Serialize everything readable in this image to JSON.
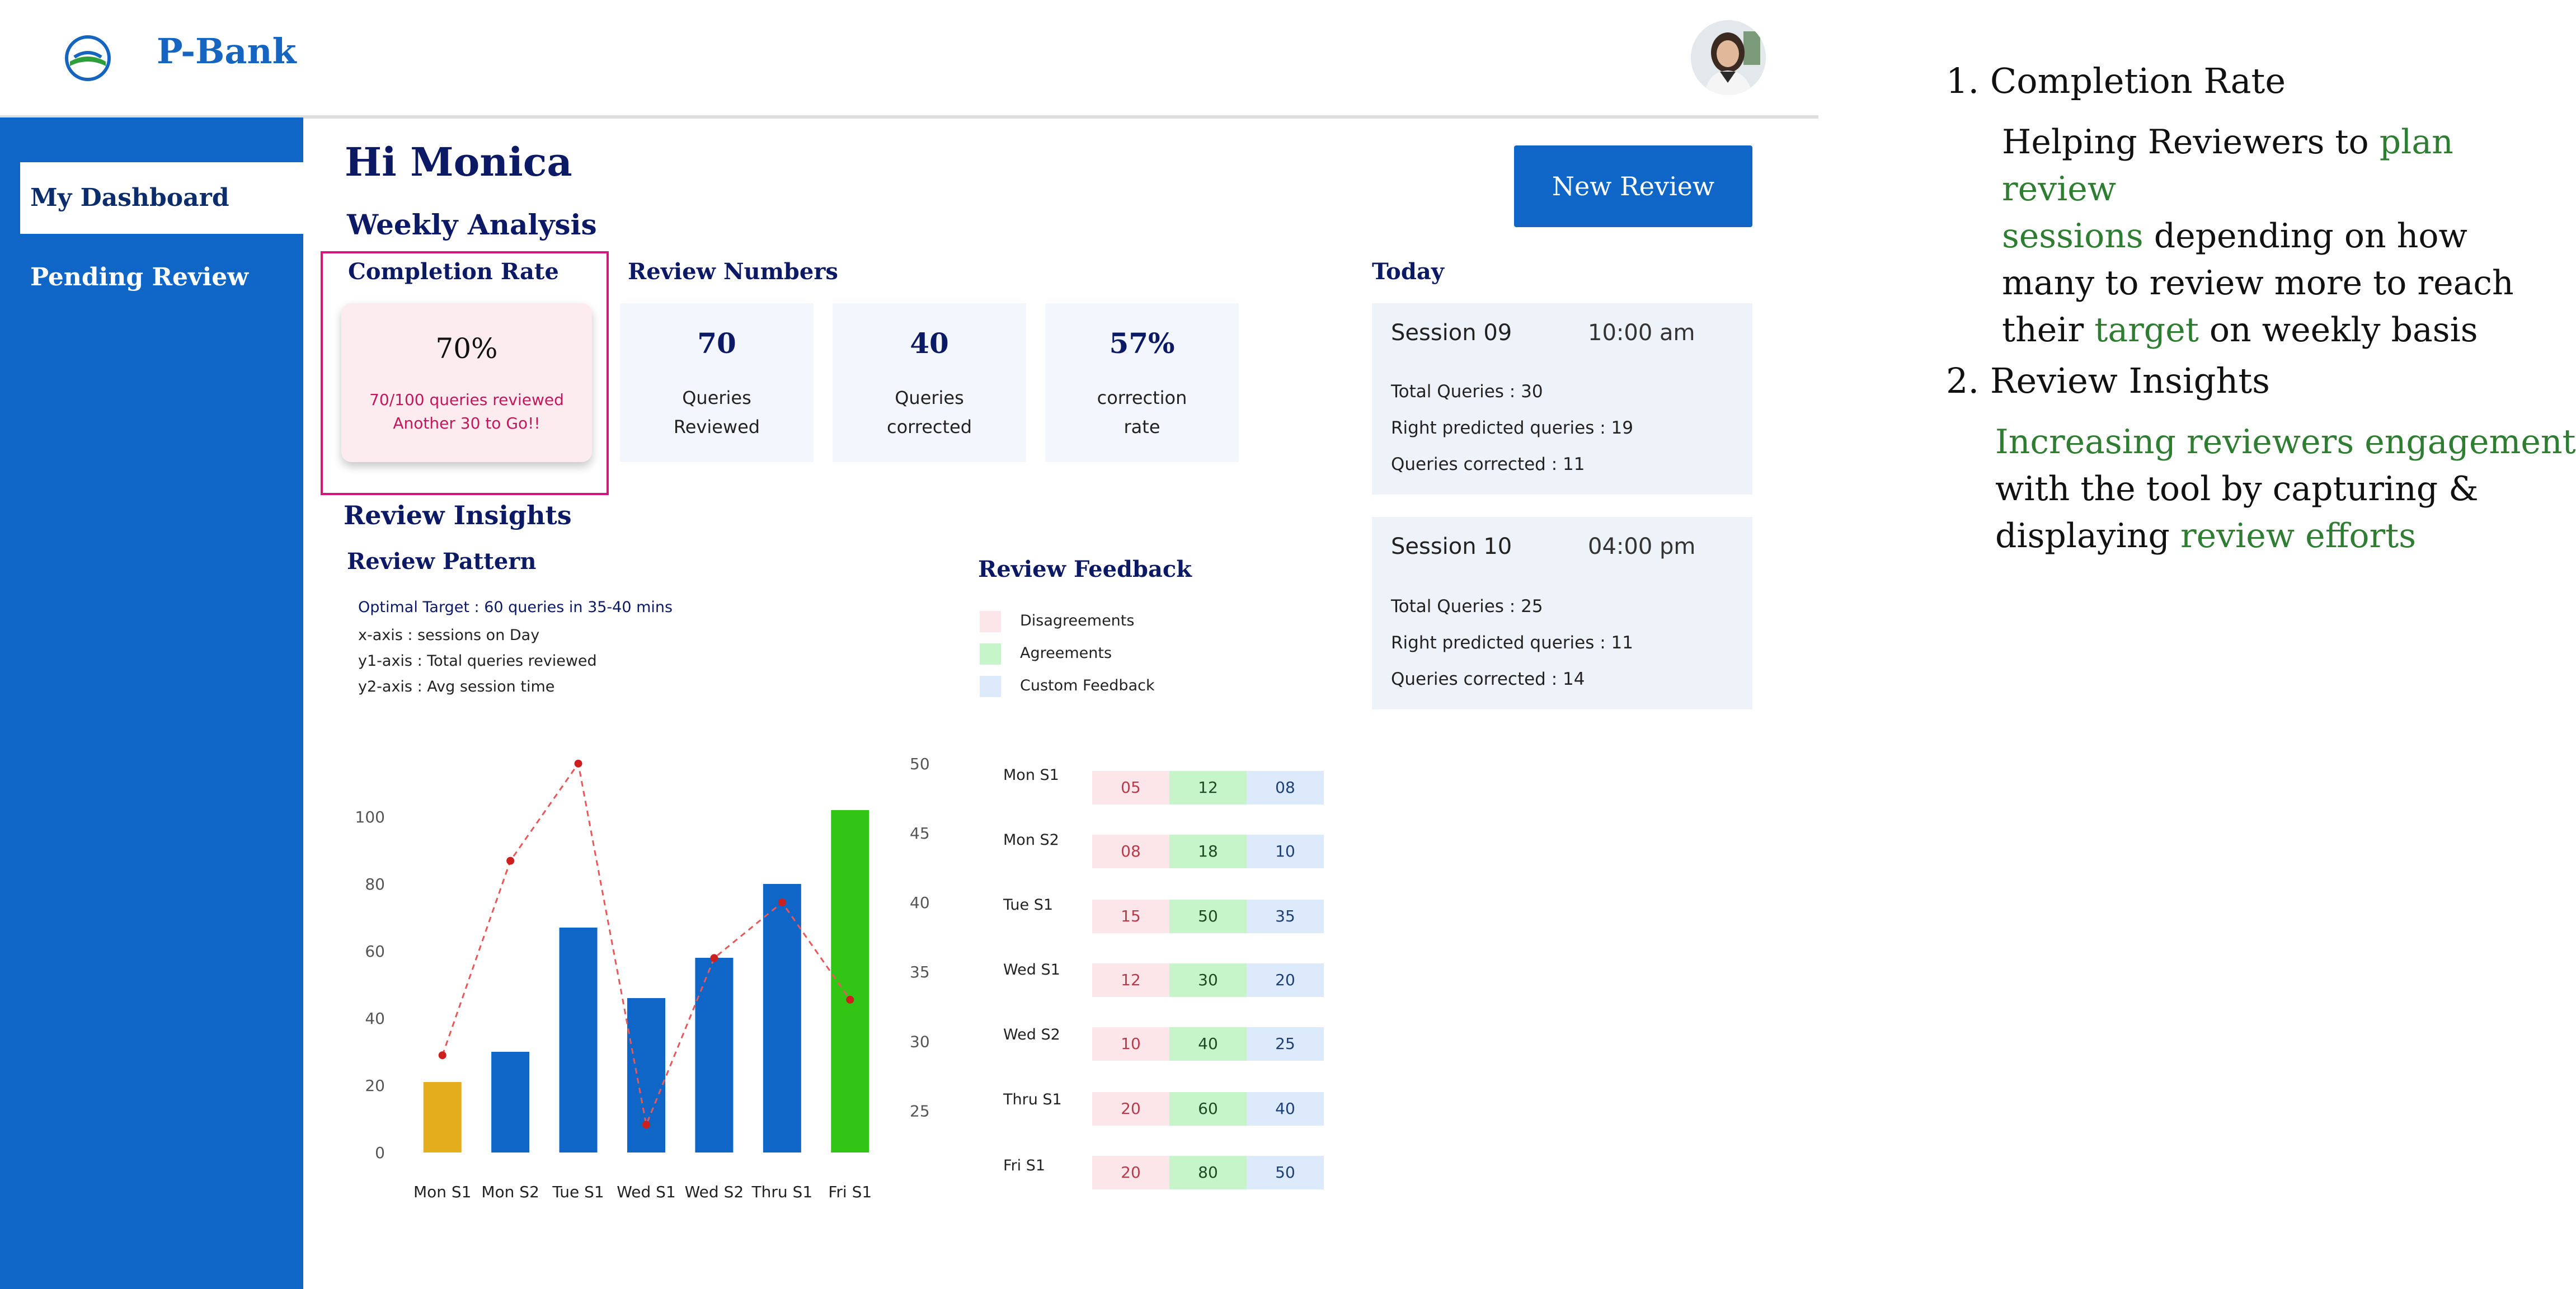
{
  "app": {
    "brand": "P-Bank"
  },
  "sidebar": {
    "items": [
      {
        "label": "My Dashboard"
      },
      {
        "label": "Pending Review"
      }
    ]
  },
  "main": {
    "greeting": "Hi Monica",
    "weekly_title": "Weekly Analysis",
    "new_review_label": "New Review",
    "completion": {
      "title": "Completion Rate",
      "percent": "70%",
      "line1": "70/100 queries reviewed",
      "line2": "Another 30 to Go!!"
    },
    "review_numbers": {
      "title": "Review Numbers",
      "cards": [
        {
          "value": "70",
          "line1": "Queries",
          "line2": "Reviewed"
        },
        {
          "value": "40",
          "line1": "Queries",
          "line2": "corrected"
        },
        {
          "value": "57%",
          "line1": "correction",
          "line2": "rate"
        }
      ]
    },
    "today": {
      "title": "Today",
      "sessions": [
        {
          "name": "Session  09",
          "time": "10:00 am",
          "total": "Total Queries : 30",
          "right": "Right predicted queries : 19",
          "corrected": "Queries corrected : 11"
        },
        {
          "name": "Session  10",
          "time": "04:00 pm",
          "total": "Total Queries : 25",
          "right": "Right predicted queries : 11",
          "corrected": "Queries corrected : 14"
        }
      ]
    },
    "insights_title": "Review Insights",
    "pattern": {
      "title": "Review Pattern",
      "target_note": "Optimal Target : 60 queries in 35-40 mins",
      "x_note": "x-axis : sessions on Day",
      "y1_note": "y1-axis : Total queries reviewed",
      "y2_note": "y2-axis : Avg session time"
    },
    "feedback": {
      "title": "Review Feedback",
      "legend": [
        {
          "label": "Disagreements",
          "color": "#fde6ea"
        },
        {
          "label": "Agreements",
          "color": "#c6f5c9"
        },
        {
          "label": "Custom Feedback",
          "color": "#dceafc"
        }
      ],
      "rows": [
        {
          "label": "Mon S1",
          "d": "05",
          "a": "12",
          "c": "08"
        },
        {
          "label": "Mon S2",
          "d": "08",
          "a": "18",
          "c": "10"
        },
        {
          "label": "Tue S1",
          "d": "15",
          "a": "50",
          "c": "35"
        },
        {
          "label": "Wed S1",
          "d": "12",
          "a": "30",
          "c": "20"
        },
        {
          "label": "Wed S2",
          "d": "10",
          "a": "40",
          "c": "25"
        },
        {
          "label": "Thru S1",
          "d": "20",
          "a": "60",
          "c": "40"
        },
        {
          "label": "Fri S1",
          "d": "20",
          "a": "80",
          "c": "50"
        }
      ]
    }
  },
  "chart_data": {
    "type": "bar",
    "categories": [
      "Mon S1",
      "Mon S2",
      "Tue S1",
      "Wed S1",
      "Wed S2",
      "Thru S1",
      "Fri S1"
    ],
    "values": [
      21,
      30,
      67,
      46,
      58,
      80,
      102
    ],
    "bar_colors": [
      "#e3ad1d",
      "#0f66c6",
      "#0f66c6",
      "#0f66c6",
      "#0f66c6",
      "#0f66c6",
      "#32c414"
    ],
    "y_ticks": [
      0,
      20,
      40,
      60,
      80,
      100
    ],
    "ylim": [
      0,
      120
    ],
    "series": [
      {
        "type": "line",
        "axis": "y2",
        "values": [
          29,
          43,
          50,
          24,
          36,
          40,
          33
        ]
      }
    ],
    "y2_ticks": [
      25,
      30,
      35,
      40,
      45,
      50
    ],
    "y2lim": [
      22,
      51
    ],
    "line_color": "#e8585a",
    "point_color": "#cc1f1f"
  },
  "notes": {
    "item1": {
      "heading": "1. Completion Rate",
      "lines": [
        [
          {
            "t": "Helping Reviewers to ",
            "g": false
          },
          {
            "t": "plan review",
            "g": true
          }
        ],
        [
          {
            "t": "sessions",
            "g": true
          },
          {
            "t": " depending on how",
            "g": false
          }
        ],
        [
          {
            "t": "many to review more to reach",
            "g": false
          }
        ],
        [
          {
            "t": "their ",
            "g": false
          },
          {
            "t": "target",
            "g": true
          },
          {
            "t": " on weekly basis",
            "g": false
          }
        ]
      ]
    },
    "item2": {
      "heading": "2. Review Insights",
      "lines": [
        [
          {
            "t": "Increasing reviewers engagement",
            "g": true
          }
        ],
        [
          {
            "t": "with the tool by capturing &",
            "g": false
          }
        ],
        [
          {
            "t": "displaying ",
            "g": false
          },
          {
            "t": "review efforts",
            "g": true
          }
        ]
      ]
    }
  }
}
